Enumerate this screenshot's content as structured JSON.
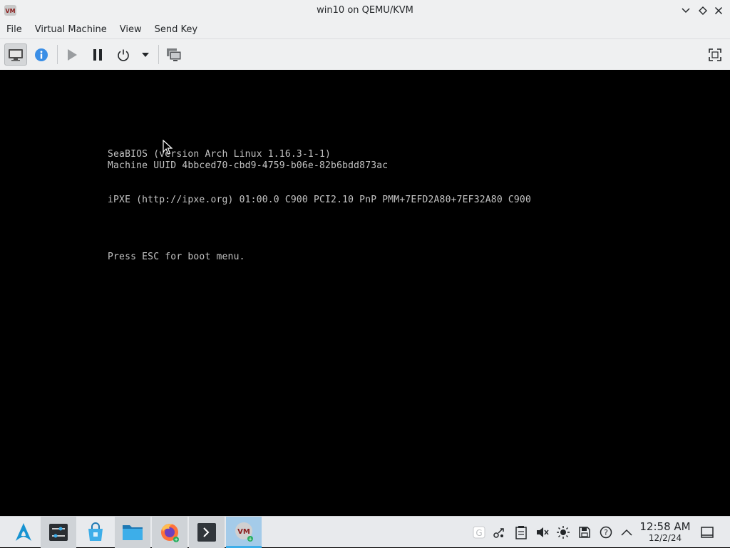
{
  "window": {
    "title": "win10 on QEMU/KVM",
    "app_icon": "virt-manager-icon"
  },
  "menu": {
    "items": [
      "File",
      "Virtual Machine",
      "View",
      "Send Key"
    ]
  },
  "toolbar": {
    "buttons": [
      {
        "name": "console-view-icon",
        "active": true
      },
      {
        "name": "details-info-icon",
        "active": false
      },
      {
        "name": "run-play-icon",
        "active": false
      },
      {
        "name": "pause-icon",
        "active": false
      },
      {
        "name": "power-icon",
        "active": false
      },
      {
        "name": "shutdown-menu-arrow-icon",
        "active": false
      },
      {
        "name": "snapshots-icon",
        "active": false
      },
      {
        "name": "fullscreen-icon",
        "active": false
      }
    ]
  },
  "console": {
    "lines": [
      "SeaBIOS (version Arch Linux 1.16.3-1-1)",
      "Machine UUID 4bbced70-cbd9-4759-b06e-82b6bdd873ac",
      "iPXE (http://ipxe.org) 01:00.0 C900 PCI2.10 PnP PMM+7EFD2A80+7EF32A80 C900",
      "Press ESC for boot menu."
    ]
  },
  "taskbar": {
    "launcher": "arch-linux-launcher-icon",
    "tasks": [
      "system-settings-icon",
      "discover-store-icon",
      "dolphin-files-icon",
      "firefox-icon",
      "konsole-terminal-icon",
      "virt-manager-icon"
    ],
    "tray": [
      "clipboard-icon",
      "kde-connect-icon",
      "notes-icon",
      "volume-muted-icon",
      "brightness-icon",
      "storage-icon",
      "help-icon",
      "expand-tray-icon"
    ],
    "clock": {
      "time": "12:58 AM",
      "date": "12/2/24"
    },
    "show_desktop": "show-desktop-icon"
  },
  "colors": {
    "chrome_bg": "#eff0f1",
    "console_bg": "#000000",
    "console_text": "#c4c4c4",
    "accent": "#3daee9"
  }
}
